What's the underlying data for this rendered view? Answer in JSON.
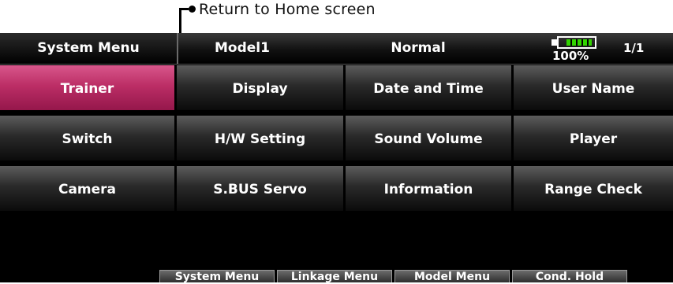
{
  "annotation": {
    "text": "Return to Home screen"
  },
  "header": {
    "title": "System Menu",
    "model": "Model1",
    "condition": "Normal",
    "battery_percent": "100%",
    "page_indicator": "1/1",
    "battery_color": "#32d400"
  },
  "menu": {
    "items": [
      {
        "label": "Trainer",
        "active": true
      },
      {
        "label": "Display"
      },
      {
        "label": "Date and Time"
      },
      {
        "label": "User Name"
      },
      {
        "label": "Switch"
      },
      {
        "label": "H/W Setting"
      },
      {
        "label": "Sound Volume"
      },
      {
        "label": "Player"
      },
      {
        "label": "Camera"
      },
      {
        "label": "S.BUS Servo"
      },
      {
        "label": "Information"
      },
      {
        "label": "Range Check"
      }
    ],
    "active_color": "#bc2e66"
  },
  "footer_tabs": [
    {
      "label": "System Menu"
    },
    {
      "label": "Linkage Menu"
    },
    {
      "label": "Model Menu"
    },
    {
      "label": "Cond. Hold"
    }
  ]
}
